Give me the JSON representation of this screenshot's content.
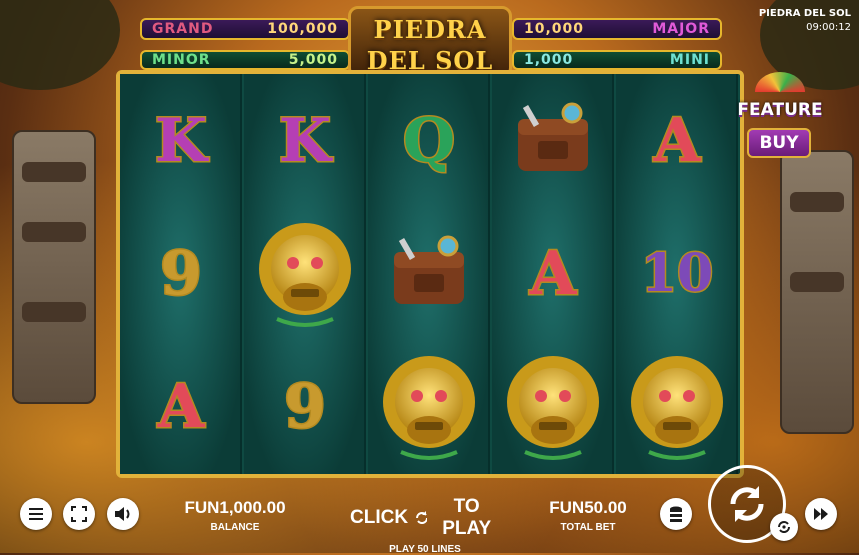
{
  "game": {
    "title": "PIEDRA DEL SOL",
    "clock": "09:00:12",
    "logo_line1": "PIEDRA",
    "logo_line2": "DEL SOL"
  },
  "jackpots": {
    "grand": {
      "name": "GRAND",
      "value": "100,000",
      "color": "#e05a80"
    },
    "minor": {
      "name": "MINOR",
      "value": "5,000",
      "color": "#6ee08a"
    },
    "major": {
      "name": "MAJOR",
      "value": "10,000",
      "color": "#e05ad8"
    },
    "mini": {
      "name": "MINI",
      "value": "1,000",
      "color": "#6ee0d0"
    }
  },
  "feature_buy": {
    "line1": "FEATURE",
    "line2": "BUY"
  },
  "reels": [
    [
      "K",
      "9",
      "A"
    ],
    [
      "K",
      "mask",
      "9"
    ],
    [
      "Q",
      "bag",
      "mask"
    ],
    [
      "bag",
      "A",
      "mask"
    ],
    [
      "A",
      "10",
      "mask"
    ]
  ],
  "bottom_bar": {
    "balance_value": "FUN1,000.00",
    "balance_label": "BALANCE",
    "click_to_play_left": "CLICK",
    "click_to_play_right": "TO PLAY",
    "play_lines": "PLAY 50 LINES",
    "total_bet_value": "FUN50.00",
    "total_bet_label": "TOTAL BET"
  },
  "icons": {
    "menu": "menu-icon",
    "fullscreen": "fullscreen-icon",
    "sound": "speaker-icon",
    "bet": "coin-stack-icon",
    "spin": "spin-arrows-icon",
    "autoplay": "autoplay-icon",
    "turbo": "fast-forward-icon"
  }
}
